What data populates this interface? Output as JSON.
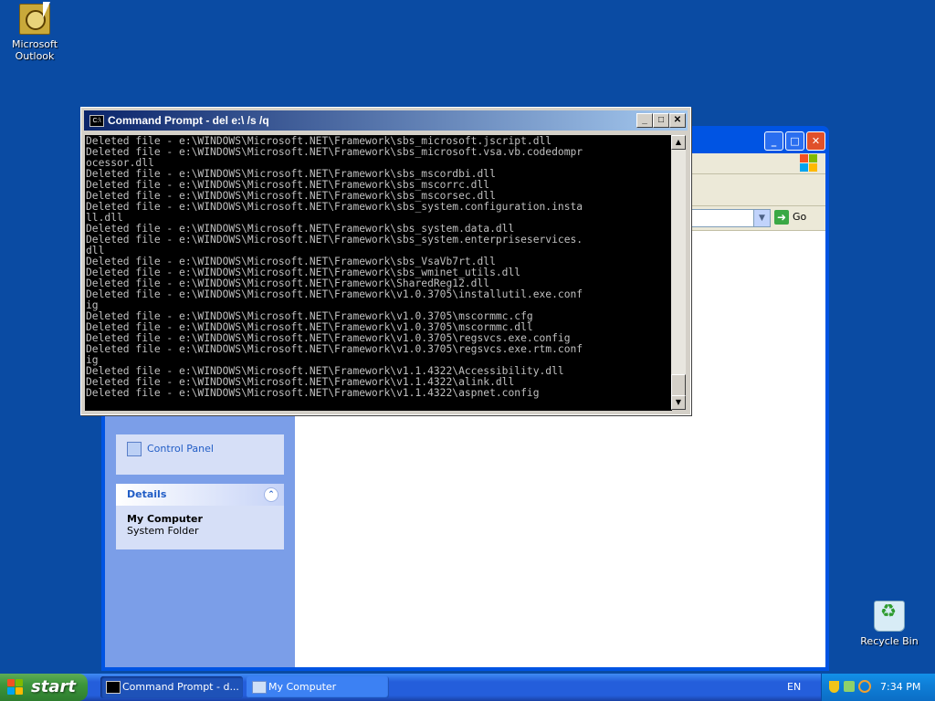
{
  "desktop": {
    "icons": [
      {
        "label_line1": "Microsoft",
        "label_line2": "Outlook"
      },
      {
        "label_line1": "Recycle Bin",
        "label_line2": ""
      }
    ]
  },
  "explorer": {
    "go_label": "Go",
    "control_panel_label": "Control Panel",
    "details_header": "Details",
    "details_title": "My Computer",
    "details_subtitle": "System Folder"
  },
  "cmd": {
    "title": "Command Prompt - del e:\\ /s /q",
    "lines": [
      "Deleted file - e:\\WINDOWS\\Microsoft.NET\\Framework\\sbs_microsoft.jscript.dll",
      "Deleted file - e:\\WINDOWS\\Microsoft.NET\\Framework\\sbs_microsoft.vsa.vb.codedompr",
      "ocessor.dll",
      "Deleted file - e:\\WINDOWS\\Microsoft.NET\\Framework\\sbs_mscordbi.dll",
      "Deleted file - e:\\WINDOWS\\Microsoft.NET\\Framework\\sbs_mscorrc.dll",
      "Deleted file - e:\\WINDOWS\\Microsoft.NET\\Framework\\sbs_mscorsec.dll",
      "Deleted file - e:\\WINDOWS\\Microsoft.NET\\Framework\\sbs_system.configuration.insta",
      "ll.dll",
      "Deleted file - e:\\WINDOWS\\Microsoft.NET\\Framework\\sbs_system.data.dll",
      "Deleted file - e:\\WINDOWS\\Microsoft.NET\\Framework\\sbs_system.enterpriseservices.",
      "dll",
      "Deleted file - e:\\WINDOWS\\Microsoft.NET\\Framework\\sbs_VsaVb7rt.dll",
      "Deleted file - e:\\WINDOWS\\Microsoft.NET\\Framework\\sbs_wminet_utils.dll",
      "Deleted file - e:\\WINDOWS\\Microsoft.NET\\Framework\\SharedReg12.dll",
      "Deleted file - e:\\WINDOWS\\Microsoft.NET\\Framework\\v1.0.3705\\installutil.exe.conf",
      "ig",
      "Deleted file - e:\\WINDOWS\\Microsoft.NET\\Framework\\v1.0.3705\\mscormmc.cfg",
      "Deleted file - e:\\WINDOWS\\Microsoft.NET\\Framework\\v1.0.3705\\mscormmc.dll",
      "Deleted file - e:\\WINDOWS\\Microsoft.NET\\Framework\\v1.0.3705\\regsvcs.exe.config",
      "Deleted file - e:\\WINDOWS\\Microsoft.NET\\Framework\\v1.0.3705\\regsvcs.exe.rtm.conf",
      "ig",
      "Deleted file - e:\\WINDOWS\\Microsoft.NET\\Framework\\v1.1.4322\\Accessibility.dll",
      "Deleted file - e:\\WINDOWS\\Microsoft.NET\\Framework\\v1.1.4322\\alink.dll",
      "Deleted file - e:\\WINDOWS\\Microsoft.NET\\Framework\\v1.1.4322\\aspnet.config"
    ]
  },
  "taskbar": {
    "start_label": "start",
    "tasks": [
      {
        "label": "Command Prompt - d..."
      },
      {
        "label": "My Computer"
      }
    ],
    "language": "EN",
    "clock": "7:34 PM"
  },
  "colors": {
    "desktop": "#0a4ba3",
    "console_bg": "#000000",
    "console_fg": "#c0c0c0"
  }
}
